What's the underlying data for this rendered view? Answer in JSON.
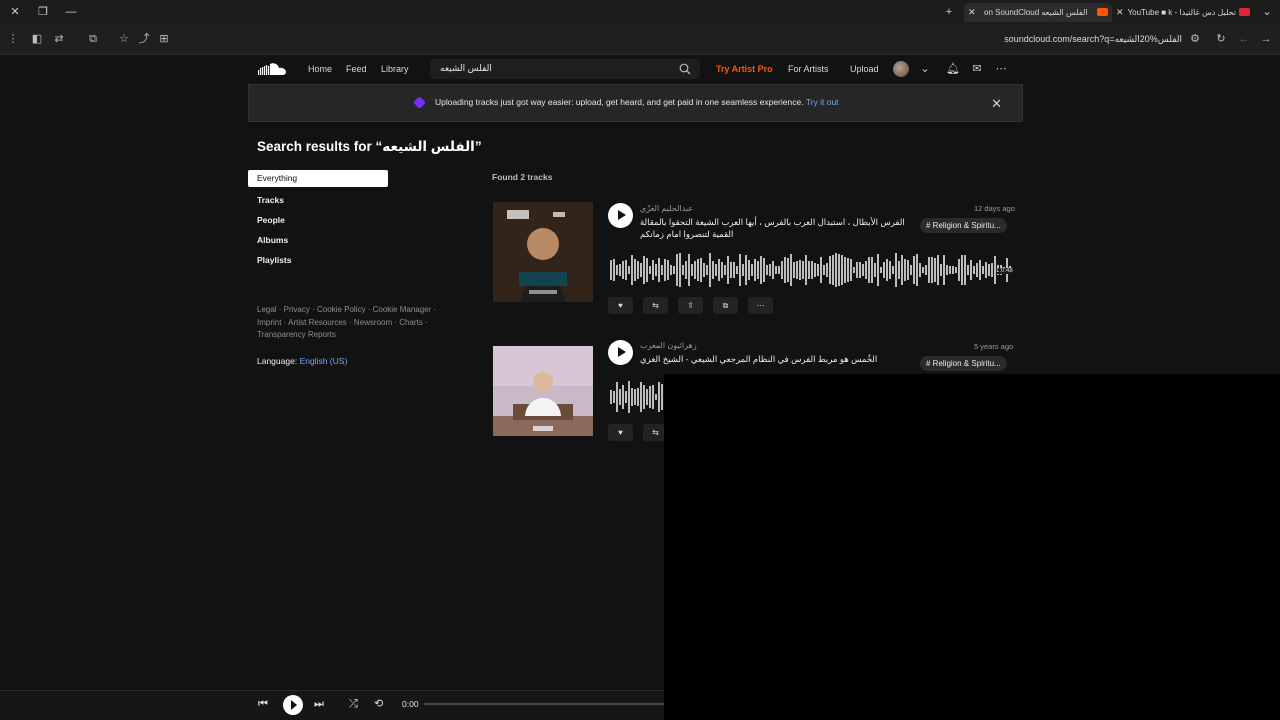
{
  "browser": {
    "tabs": [
      {
        "label": "الفلس الشيعه on SoundCloud",
        "active": true
      },
      {
        "label": "تحليل دس غالتيدا - YouTube ■ k",
        "active": false
      }
    ],
    "url": "soundcloud.com/search?q=الفلس%20الشيعه"
  },
  "header": {
    "nav": [
      "Home",
      "Feed",
      "Library"
    ],
    "search_value": "الفلس الشيعه",
    "try_pro": "Try Artist Pro",
    "for_artists": "For Artists",
    "upload": "Upload"
  },
  "banner": {
    "text": "Uploading tracks just got way easier: upload, get heard, and get paid in one seamless experience.",
    "link": "Try it out"
  },
  "results": {
    "title": "Search results for “الفلس الشيعه”",
    "found": "Found 2 tracks"
  },
  "filters": [
    "Everything",
    "Tracks",
    "People",
    "Albums",
    "Playlists"
  ],
  "footer": {
    "links": "Legal · Privacy · Cookie Policy · Cookie Manager · Imprint · Artist Resources · Newsroom · Charts · Transparency Reports",
    "language_label": "Language:",
    "language_value": "English (US)"
  },
  "tracks": [
    {
      "uploader": "عبدالحليم الغزّي",
      "title": "الفرس الأبطال ، استبدال العرب بالفرس ، أيها العرب الشيعة التحقوا بالمقالة القمية لتنصروا امام زمانكم",
      "date": "12 days ago",
      "tag": "# Religion & Spiritu...",
      "duration": "1:0:48"
    },
    {
      "uploader": "زهرائيون المغرب",
      "title": "الخُمس هو مربط الفرس في النظام المرجعي الشيعي - الشيخ الغزي",
      "date": "5 years ago",
      "tag": "# Religion & Spiritu..."
    }
  ],
  "player": {
    "time": "0:00"
  },
  "colors": {
    "accent": "#ff5500",
    "link": "#7aa6ff"
  }
}
